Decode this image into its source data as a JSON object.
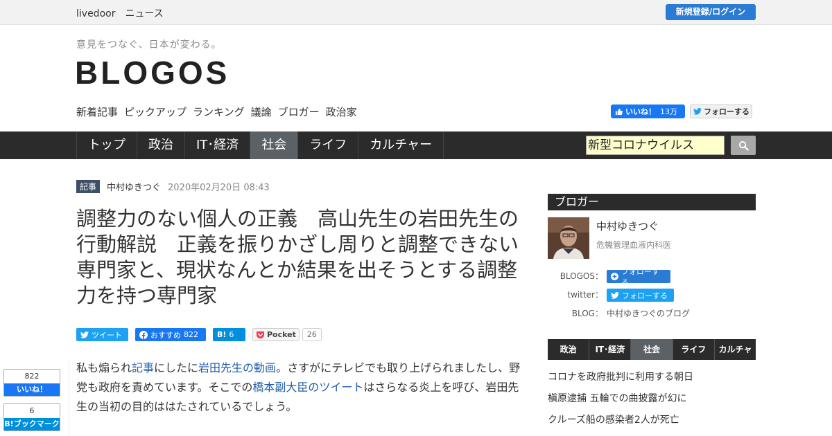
{
  "topbar": {
    "brand": "livedoor　ニュース",
    "login_label": "新規登録/ログイン"
  },
  "header": {
    "tagline": "意見をつなぐ、日本が変わる。",
    "logo": "BLOGOS",
    "subnav": [
      "新着記事",
      "ピックアップ",
      "ランキング",
      "議論",
      "ブロガー",
      "政治家"
    ],
    "fb_like_label": "いいね！",
    "fb_like_count": "13万",
    "tw_follow_label": "フォローする"
  },
  "mainnav": {
    "tabs": [
      "トップ",
      "政治",
      "IT･経済",
      "社会",
      "ライフ",
      "カルチャー"
    ],
    "active_index": 3,
    "search_value": "新型コロナウイルス"
  },
  "article": {
    "kind": "記事",
    "author": "中村ゆきつぐ",
    "date": "2020年02月20日 08:43",
    "title": "調整力のない個人の正義　高山先生の岩田先生の行動解説　正義を振りかざし周りと調整できない専門家と、現状なんとか結果を出そうとする調整力を持つ専門家",
    "share": {
      "tweet_label": "ツイート",
      "fb_label": "おすすめ",
      "fb_count": "822",
      "hatena_label": "B!",
      "hatena_count": "6",
      "pocket_label": "Pocket",
      "pocket_count": "26"
    },
    "body": {
      "t1": "私も煽られ",
      "l1": "記事",
      "t2": "にしたに",
      "l2": "岩田先生の動画",
      "t3": "。さすがにテレビでも取り上げられましたし、野党も政府を責めています。そこでの",
      "l3": "橋本副大臣のツイート",
      "t4": "はさらなる炎上を呼び、岩田先生の当初の目的ははたされているでしょう。"
    }
  },
  "float_share": {
    "fb_count": "822",
    "fb_label": "いいね！",
    "hatena_count": "6",
    "hatena_label": "B!ブックマーク"
  },
  "sidebar": {
    "heading": "ブロガー",
    "blogger_name": "中村ゆきつぐ",
    "blogger_role": "危機管理血液内科医",
    "blogos_label": "BLOGOS：",
    "blogos_follow": "フォローする",
    "twitter_label": "twitter：",
    "twitter_follow": "フォローする",
    "blog_label": "BLOG：",
    "blog_name": "中村ゆきつぐのブログ",
    "category_tabs": [
      "政治",
      "IT･経済",
      "社会",
      "ライフ",
      "カルチャー"
    ],
    "category_active_index": 2,
    "headlines": [
      "コロナを政府批判に利用する朝日",
      "槇原逮捕 五輪での曲披露が幻に",
      "クルーズ船の感染者2人が死亡"
    ]
  },
  "colors": {
    "nav_bg": "#2b2b2b",
    "nav_active": "#5c6166",
    "link": "#1f5da8",
    "login_blue": "#2a7bd3",
    "search_bg": "#ffffcc"
  }
}
